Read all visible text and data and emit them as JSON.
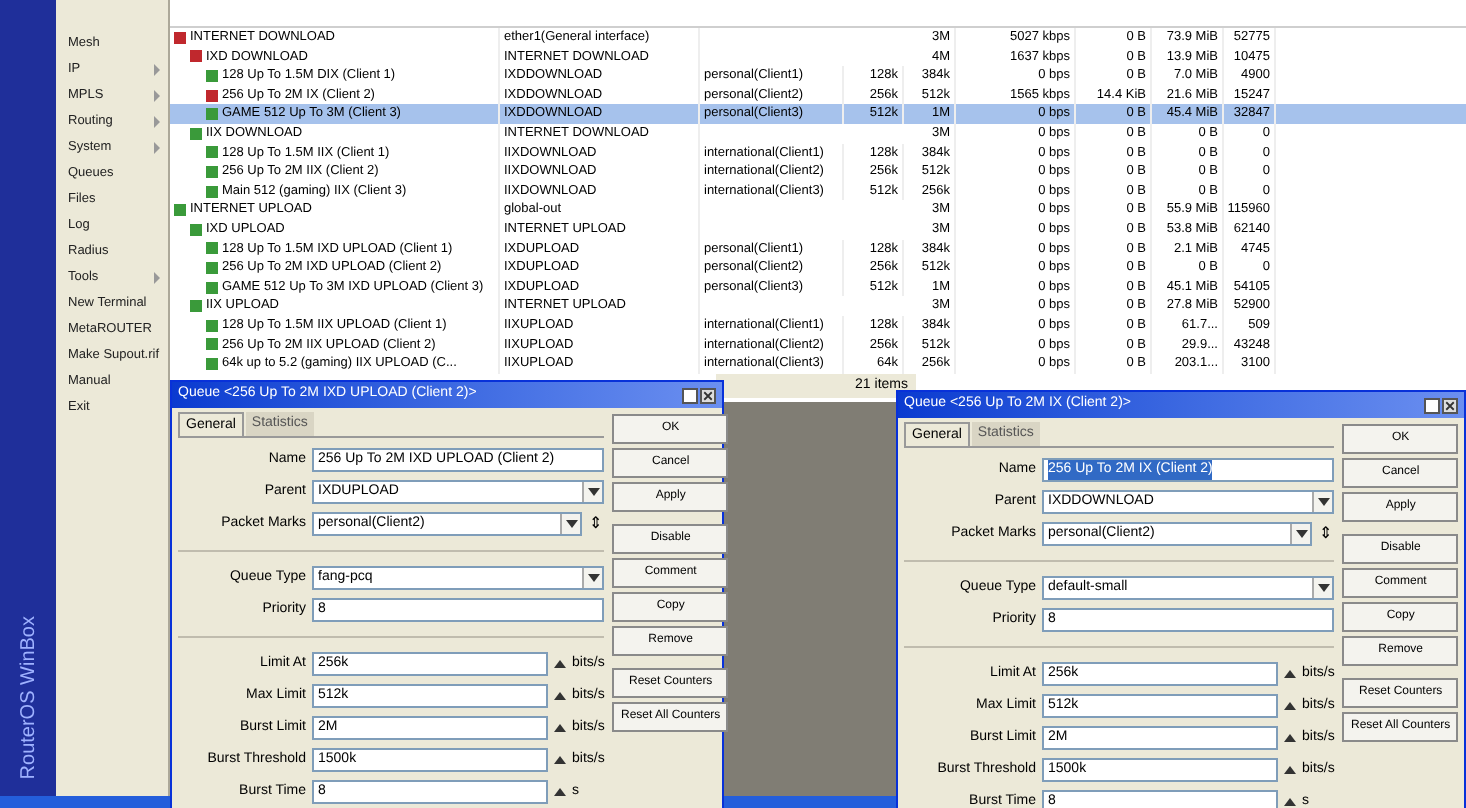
{
  "brand": "RouterOS WinBox",
  "menu": [
    {
      "label": "Mesh",
      "submenu": false
    },
    {
      "label": "IP",
      "submenu": true
    },
    {
      "label": "MPLS",
      "submenu": true
    },
    {
      "label": "Routing",
      "submenu": true
    },
    {
      "label": "System",
      "submenu": true
    },
    {
      "label": "Queues",
      "submenu": false
    },
    {
      "label": "Files",
      "submenu": false
    },
    {
      "label": "Log",
      "submenu": false
    },
    {
      "label": "Radius",
      "submenu": false
    },
    {
      "label": "Tools",
      "submenu": true
    },
    {
      "label": "New Terminal",
      "submenu": false
    },
    {
      "label": "MetaROUTER",
      "submenu": false
    },
    {
      "label": "Make Supout.rif",
      "submenu": false
    },
    {
      "label": "Manual",
      "submenu": false
    },
    {
      "label": "Exit",
      "submenu": false
    }
  ],
  "queue_tree": {
    "item_count": "21 items",
    "rows": [
      {
        "color": "#c0282d",
        "selected": false,
        "cells": [
          "INTERNET DOWNLOAD",
          "ether1(General interface)",
          "",
          "",
          "3M",
          "5027 kbps",
          "0 B",
          "73.9 MiB",
          "52775"
        ],
        "children": [
          {
            "color": "#c0282d",
            "selected": false,
            "cells": [
              "IXD DOWNLOAD",
              "INTERNET DOWNLOAD",
              "",
              "",
              "4M",
              "1637 kbps",
              "0 B",
              "13.9 MiB",
              "10475"
            ],
            "children": [
              {
                "color": "#3a9a3a",
                "selected": false,
                "cells": [
                  "128 Up To 1.5M DIX (Client 1)",
                  "IXDDOWNLOAD",
                  "personal(Client1)",
                  "128k",
                  "384k",
                  "0 bps",
                  "0 B",
                  "7.0 MiB",
                  "4900"
                ]
              },
              {
                "color": "#c0282d",
                "selected": false,
                "cells": [
                  "256 Up To 2M IX (Client 2)",
                  "IXDDOWNLOAD",
                  "personal(Client2)",
                  "256k",
                  "512k",
                  "1565 kbps",
                  "14.4 KiB",
                  "21.6 MiB",
                  "15247"
                ]
              },
              {
                "color": "#3a9a3a",
                "selected": true,
                "cells": [
                  "GAME 512 Up To 3M (Client 3)",
                  "IXDDOWNLOAD",
                  "personal(Client3)",
                  "512k",
                  "1M",
                  "0 bps",
                  "0 B",
                  "45.4 MiB",
                  "32847"
                ]
              }
            ]
          },
          {
            "color": "#3a9a3a",
            "selected": false,
            "cells": [
              "IIX DOWNLOAD",
              "INTERNET DOWNLOAD",
              "",
              "",
              "3M",
              "0 bps",
              "0 B",
              "0 B",
              "0"
            ],
            "children": [
              {
                "color": "#3a9a3a",
                "selected": false,
                "cells": [
                  "128 Up To 1.5M IIX (Client 1)",
                  "IIXDOWNLOAD",
                  "international(Client1)",
                  "128k",
                  "384k",
                  "0 bps",
                  "0 B",
                  "0 B",
                  "0"
                ]
              },
              {
                "color": "#3a9a3a",
                "selected": false,
                "cells": [
                  "256 Up To 2M IIX (Client 2)",
                  "IIXDOWNLOAD",
                  "international(Client2)",
                  "256k",
                  "512k",
                  "0 bps",
                  "0 B",
                  "0 B",
                  "0"
                ]
              },
              {
                "color": "#3a9a3a",
                "selected": false,
                "cells": [
                  "Main 512 (gaming) IIX (Client 3)",
                  "IIXDOWNLOAD",
                  "international(Client3)",
                  "512k",
                  "256k",
                  "0 bps",
                  "0 B",
                  "0 B",
                  "0"
                ]
              }
            ]
          }
        ]
      },
      {
        "color": "#3a9a3a",
        "selected": false,
        "cells": [
          "INTERNET UPLOAD",
          "global-out",
          "",
          "",
          "3M",
          "0 bps",
          "0 B",
          "55.9 MiB",
          "115960"
        ],
        "children": [
          {
            "color": "#3a9a3a",
            "selected": false,
            "cells": [
              "IXD UPLOAD",
              "INTERNET UPLOAD",
              "",
              "",
              "3M",
              "0 bps",
              "0 B",
              "53.8 MiB",
              "62140"
            ],
            "children": [
              {
                "color": "#3a9a3a",
                "selected": false,
                "cells": [
                  "128 Up To 1.5M IXD UPLOAD (Client 1)",
                  "IXDUPLOAD",
                  "personal(Client1)",
                  "128k",
                  "384k",
                  "0 bps",
                  "0 B",
                  "2.1 MiB",
                  "4745"
                ]
              },
              {
                "color": "#3a9a3a",
                "selected": false,
                "cells": [
                  "256 Up To 2M IXD UPLOAD (Client 2)",
                  "IXDUPLOAD",
                  "personal(Client2)",
                  "256k",
                  "512k",
                  "0 bps",
                  "0 B",
                  "0 B",
                  "0"
                ]
              },
              {
                "color": "#3a9a3a",
                "selected": false,
                "cells": [
                  "GAME 512 Up To 3M IXD UPLOAD (Client 3)",
                  "IXDUPLOAD",
                  "personal(Client3)",
                  "512k",
                  "1M",
                  "0 bps",
                  "0 B",
                  "45.1 MiB",
                  "54105"
                ]
              }
            ]
          },
          {
            "color": "#3a9a3a",
            "selected": false,
            "cells": [
              "IIX UPLOAD",
              "INTERNET UPLOAD",
              "",
              "",
              "3M",
              "0 bps",
              "0 B",
              "27.8 MiB",
              "52900"
            ],
            "children": [
              {
                "color": "#3a9a3a",
                "selected": false,
                "cells": [
                  "128 Up To 1.5M IIX UPLOAD (Client 1)",
                  "IIXUPLOAD",
                  "international(Client1)",
                  "128k",
                  "384k",
                  "0 bps",
                  "0 B",
                  "61.7...",
                  "509"
                ]
              },
              {
                "color": "#3a9a3a",
                "selected": false,
                "cells": [
                  "256 Up To 2M IIX UPLOAD (Client 2)",
                  "IIXUPLOAD",
                  "international(Client2)",
                  "256k",
                  "512k",
                  "0 bps",
                  "0 B",
                  "29.9...",
                  "43248"
                ]
              },
              {
                "color": "#3a9a3a",
                "selected": false,
                "cells": [
                  "64k up to 5.2 (gaming) IIX UPLOAD (C...",
                  "IIXUPLOAD",
                  "international(Client3)",
                  "64k",
                  "256k",
                  "0 bps",
                  "0 B",
                  "203.1...",
                  "3100"
                ]
              }
            ]
          }
        ]
      }
    ]
  },
  "dialogs": [
    {
      "title": "Queue <256 Up To 2M IXD UPLOAD (Client 2)>",
      "tabs": [
        {
          "label": "General",
          "selected": true
        },
        {
          "label": "Statistics",
          "selected": false
        }
      ],
      "fields": [
        {
          "label": "Name",
          "value": "256 Up To 2M IXD UPLOAD (Client 2)",
          "dropdown": false,
          "highlighted": false,
          "separator_before": false
        },
        {
          "label": "Parent",
          "value": "IXDUPLOAD",
          "dropdown": true,
          "highlighted": false,
          "separator_before": false
        },
        {
          "label": "Packet Marks",
          "value": "personal(Client2)",
          "dropdown": true,
          "spinner": "⇕",
          "highlighted": false,
          "separator_before": false
        },
        {
          "label": "Queue Type",
          "value": "fang-pcq",
          "dropdown": true,
          "highlighted": false,
          "separator_before": true
        },
        {
          "label": "Priority",
          "value": "8",
          "dropdown": false,
          "highlighted": false,
          "separator_before": false
        },
        {
          "label": "Limit At",
          "value": "256k",
          "dropdown": false,
          "unit": "bits/s",
          "highlighted": false,
          "separator_before": true
        },
        {
          "label": "Max Limit",
          "value": "512k",
          "dropdown": false,
          "unit": "bits/s",
          "highlighted": false,
          "separator_before": false
        },
        {
          "label": "Burst Limit",
          "value": "2M",
          "dropdown": false,
          "unit": "bits/s",
          "highlighted": false,
          "separator_before": false
        },
        {
          "label": "Burst Threshold",
          "value": "1500k",
          "dropdown": false,
          "unit": "bits/s",
          "highlighted": false,
          "separator_before": false
        },
        {
          "label": "Burst Time",
          "value": "8",
          "dropdown": false,
          "unit": "s",
          "highlighted": false,
          "separator_before": false
        }
      ],
      "buttons": [
        "OK",
        "Cancel",
        "Apply",
        "Disable",
        "Comment",
        "Copy",
        "Remove",
        "Reset Counters",
        "Reset All Counters"
      ]
    },
    {
      "title": "Queue <256 Up To 2M IX (Client 2)>",
      "tabs": [
        {
          "label": "General",
          "selected": true
        },
        {
          "label": "Statistics",
          "selected": false
        }
      ],
      "fields": [
        {
          "label": "Name",
          "value": "256 Up To 2M IX (Client 2)",
          "dropdown": false,
          "highlighted": true,
          "separator_before": false
        },
        {
          "label": "Parent",
          "value": "IXDDOWNLOAD",
          "dropdown": true,
          "highlighted": false,
          "separator_before": false
        },
        {
          "label": "Packet Marks",
          "value": "personal(Client2)",
          "dropdown": true,
          "spinner": "⇕",
          "highlighted": false,
          "separator_before": false
        },
        {
          "label": "Queue Type",
          "value": "default-small",
          "dropdown": true,
          "highlighted": false,
          "separator_before": true
        },
        {
          "label": "Priority",
          "value": "8",
          "dropdown": false,
          "highlighted": false,
          "separator_before": false
        },
        {
          "label": "Limit At",
          "value": "256k",
          "dropdown": false,
          "unit": "bits/s",
          "highlighted": false,
          "separator_before": true
        },
        {
          "label": "Max Limit",
          "value": "512k",
          "dropdown": false,
          "unit": "bits/s",
          "highlighted": false,
          "separator_before": false
        },
        {
          "label": "Burst Limit",
          "value": "2M",
          "dropdown": false,
          "unit": "bits/s",
          "highlighted": false,
          "separator_before": false
        },
        {
          "label": "Burst Threshold",
          "value": "1500k",
          "dropdown": false,
          "unit": "bits/s",
          "highlighted": false,
          "separator_before": false
        },
        {
          "label": "Burst Time",
          "value": "8",
          "dropdown": false,
          "unit": "s",
          "highlighted": false,
          "separator_before": false
        }
      ],
      "buttons": [
        "OK",
        "Cancel",
        "Apply",
        "Disable",
        "Comment",
        "Copy",
        "Remove",
        "Reset Counters",
        "Reset All Counters"
      ]
    }
  ]
}
